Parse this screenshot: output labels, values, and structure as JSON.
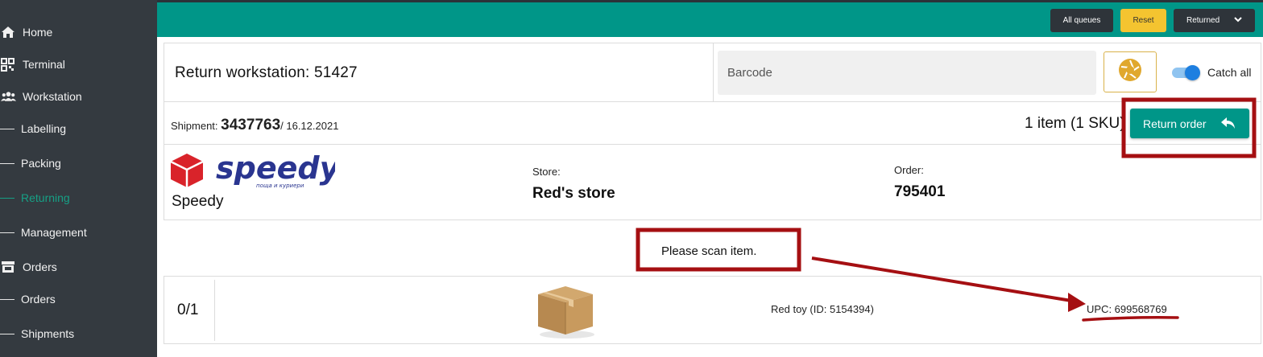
{
  "sidebar": {
    "items": [
      {
        "label": "Home",
        "icon": "home-icon"
      },
      {
        "label": "Terminal",
        "icon": "qr-code-icon"
      },
      {
        "label": "Workstation",
        "icon": "users-icon"
      },
      {
        "label": "Labelling"
      },
      {
        "label": "Packing"
      },
      {
        "label": "Returning",
        "active": true
      },
      {
        "label": "Management"
      },
      {
        "label": "Orders",
        "icon": "store-icon"
      },
      {
        "label": "Orders"
      },
      {
        "label": "Shipments"
      }
    ]
  },
  "topbar": {
    "all_queues": "All queues",
    "reset": "Reset",
    "returned": "Returned"
  },
  "header": {
    "title": "Return workstation: 51427",
    "barcode_placeholder": "Barcode",
    "catch_all": "Catch all",
    "catch_all_on": true
  },
  "shipment": {
    "label": "Shipment:",
    "number": "3437763",
    "date": "/ 16.12.2021",
    "items_count": "1 item (1 SKU)",
    "return_order": "Return order",
    "carrier_logo_text": "speedy",
    "carrier_logo_tagline": "поща и куриери",
    "carrier_name": "Speedy",
    "store_label": "Store:",
    "store_value": "Red's store",
    "order_label": "Order:",
    "order_value": "795401"
  },
  "scan_message": "Please scan item.",
  "item": {
    "qty": "0/1",
    "name": "Red toy (ID: 5154394)",
    "upc": "UPC: 699568769"
  },
  "colors": {
    "accent": "#009688",
    "sidebar_bg": "#343a40",
    "active_nav": "#16a085",
    "reset_btn": "#f4c430",
    "annotation": "#a50f12"
  }
}
